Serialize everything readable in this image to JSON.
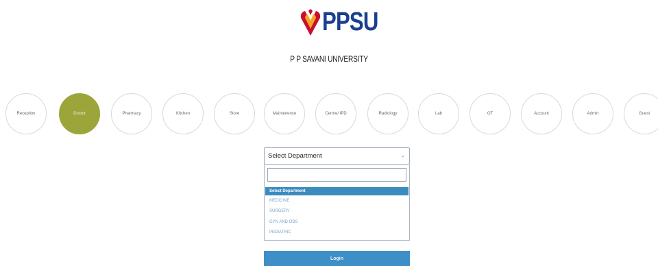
{
  "header": {
    "logo_text": "PPSU",
    "university_name": "P P SAVANI UNIVERSITY"
  },
  "roles": [
    {
      "label": "Reception",
      "active": false
    },
    {
      "label": "Doctor",
      "active": true
    },
    {
      "label": "Pharmacy",
      "active": false
    },
    {
      "label": "Kitchen",
      "active": false
    },
    {
      "label": "Store",
      "active": false
    },
    {
      "label": "Maintenence",
      "active": false
    },
    {
      "label": "Centre/ IPD",
      "active": false
    },
    {
      "label": "Radiology",
      "active": false
    },
    {
      "label": "Lab",
      "active": false
    },
    {
      "label": "OT",
      "active": false
    },
    {
      "label": "Account",
      "active": false
    },
    {
      "label": "Admin",
      "active": false
    },
    {
      "label": "Guest",
      "active": false
    }
  ],
  "department": {
    "selected_value": "Select Department",
    "search_value": "",
    "options": [
      {
        "label": "Select Department",
        "selected": true
      },
      {
        "label": "MEDICINE",
        "selected": false
      },
      {
        "label": "SURGERY",
        "selected": false
      },
      {
        "label": "GYN AND OBS",
        "selected": false
      },
      {
        "label": "PEDIATRIC",
        "selected": false
      }
    ]
  },
  "login": {
    "label": "Login"
  },
  "colors": {
    "active_role": "#9ba53a",
    "selected_option": "#3c8bbf",
    "login_button": "#3e8fc7",
    "logo_blue": "#1a3f8f"
  }
}
